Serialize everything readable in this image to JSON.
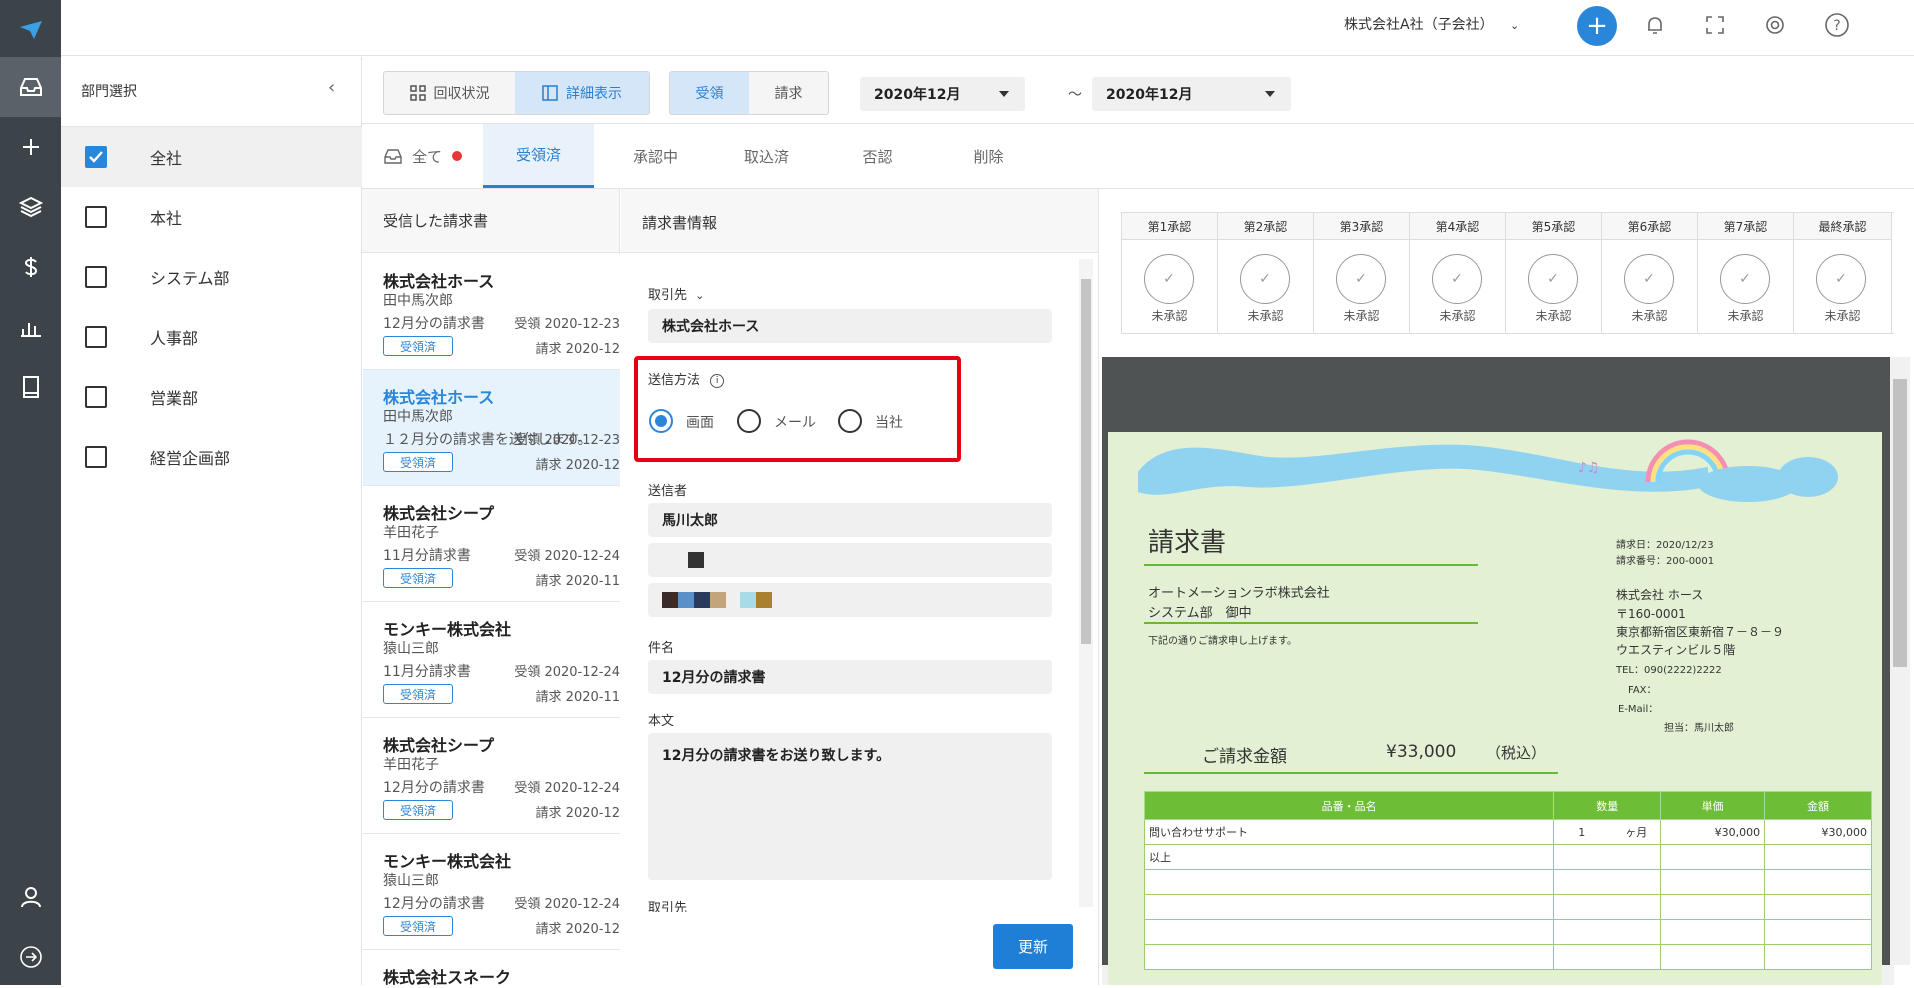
{
  "topbar": {
    "company": "株式会社A社（子会社）"
  },
  "dept_panel": {
    "title": "部門選択",
    "items": [
      {
        "label": "全社",
        "checked": true
      },
      {
        "label": "本社",
        "checked": false
      },
      {
        "label": "システム部",
        "checked": false
      },
      {
        "label": "人事部",
        "checked": false
      },
      {
        "label": "営業部",
        "checked": false
      },
      {
        "label": "経営企画部",
        "checked": false
      }
    ]
  },
  "toolbar": {
    "view_status": "回収状況",
    "view_detail": "詳細表示",
    "receive": "受領",
    "bill": "請求",
    "date_from": "2020年12月",
    "tilde": "～",
    "date_to": "2020年12月"
  },
  "tabs": [
    "全て",
    "受領済",
    "承認中",
    "取込済",
    "否認",
    "削除"
  ],
  "list": {
    "title": "受信した請求書",
    "items": [
      {
        "company": "株式会社ホース",
        "person": "田中馬次郎",
        "subject": "12月分の請求書",
        "received": "受領 2020-12-23",
        "badge": "受領済",
        "billed": "請求 2020-12"
      },
      {
        "company": "株式会社ホース",
        "person": "田中馬次郎",
        "subject": "１２月分の請求書を送付します。",
        "received": "受領 2020-12-23",
        "badge": "受領済",
        "billed": "請求 2020-12"
      },
      {
        "company": "株式会社シープ",
        "person": "羊田花子",
        "subject": "11月分請求書",
        "received": "受領 2020-12-24",
        "badge": "受領済",
        "billed": "請求 2020-11"
      },
      {
        "company": "モンキー株式会社",
        "person": "猿山三郎",
        "subject": "11月分請求書",
        "received": "受領 2020-12-24",
        "badge": "受領済",
        "billed": "請求 2020-11"
      },
      {
        "company": "株式会社シープ",
        "person": "羊田花子",
        "subject": "12月分の請求書",
        "received": "受領 2020-12-24",
        "badge": "受領済",
        "billed": "請求 2020-12"
      },
      {
        "company": "モンキー株式会社",
        "person": "猿山三郎",
        "subject": "12月分の請求書",
        "received": "受領 2020-12-24",
        "badge": "受領済",
        "billed": "請求 2020-12"
      },
      {
        "company": "株式会社スネーク",
        "person": "",
        "subject": "",
        "received": "",
        "badge": "",
        "billed": ""
      }
    ]
  },
  "form": {
    "title": "請求書情報",
    "partner_label": "取引先",
    "partner_value": "株式会社ホース",
    "method_label": "送信方法",
    "methods": [
      "画面",
      "メール",
      "当社"
    ],
    "sender_label": "送信者",
    "sender_value": "馬川太郎",
    "subject_label": "件名",
    "subject_value": "12月分の請求書",
    "body_label": "本文",
    "body_value": "12月分の請求書をお送り致します。",
    "partner_label2": "取引先",
    "update_button": "更新"
  },
  "approvals": {
    "steps": [
      "第1承認",
      "第2承認",
      "第3承認",
      "第4承認",
      "第5承認",
      "第6承認",
      "第7承認",
      "最終承認"
    ],
    "status": "未承認"
  },
  "document": {
    "title": "請求書",
    "date": "請求日：2020/12/23",
    "number": "請求番号：200-0001",
    "to_company": "オートメーションラボ株式会社",
    "to_dept": "システム部　御中",
    "notice": "下記の通りご請求申し上げます。",
    "from_company": "株式会社 ホース",
    "from_zip": "〒160-0001",
    "from_addr": "東京都新宿区東新宿７－８－９",
    "from_bldg": "ウエスティンビル５階",
    "from_tel": "TEL：090(2222)2222",
    "from_fax": "FAX：",
    "from_email": "E-Mail：",
    "from_contact": "担当：馬川太郎",
    "amount_label": "ご請求金額",
    "amount": "¥33,000",
    "tax": "（税込）",
    "table_headers": [
      "品番・品名",
      "数量",
      "単価",
      "金額"
    ],
    "rows": [
      {
        "name": "問い合わせサポート",
        "qty": "1",
        "unit": "ヶ月",
        "price": "¥30,000",
        "total": "¥30,000"
      },
      {
        "name": "以上",
        "qty": "",
        "unit": "",
        "price": "",
        "total": ""
      }
    ]
  },
  "colors": {
    "accent": "#2a86d8",
    "highlight": "#e60012",
    "rail": "#3c4349",
    "doc_bg": "#e3f0d3",
    "doc_green": "#6dbd36"
  }
}
